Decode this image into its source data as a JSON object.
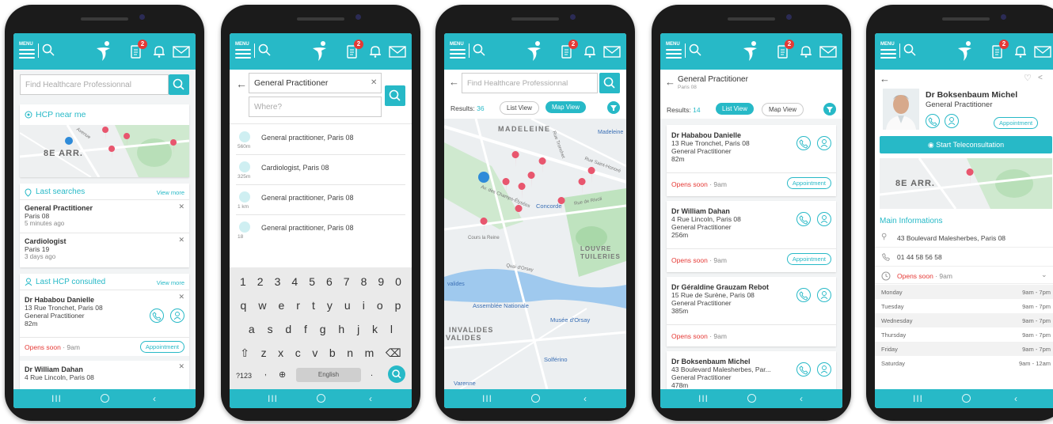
{
  "header": {
    "badge_count": "2"
  },
  "colors": {
    "accent": "#27b9c7",
    "alert": "#e53935",
    "pin": "#e8566e"
  },
  "icons": [
    "menu-icon",
    "search-icon",
    "logo-icon",
    "document-icon",
    "bell-icon",
    "mail-icon",
    "back-arrow-icon",
    "close-icon",
    "location-pin-icon",
    "clock-icon",
    "phone-icon",
    "user-icon",
    "filter-icon",
    "heart-icon",
    "share-icon",
    "video-icon"
  ],
  "menu_label": "MENU",
  "screen1": {
    "search_placeholder": "Find Healthcare Professionnal",
    "hcp_near": "HCP near me",
    "map_label": "8E ARR.",
    "map_label2": "Avenue",
    "last_searches": "Last searches",
    "view_more": "View more",
    "searches": [
      {
        "title": "General Practitioner",
        "place": "Paris 08",
        "time": "5 minutes ago"
      },
      {
        "title": "Cardiologist",
        "place": "Paris 19",
        "time": "3 days ago"
      }
    ],
    "last_consulted": "Last HCP consulted",
    "view_more2": "View more",
    "hcp1": {
      "name": "Dr Hababou Danielle",
      "addr": "13 Rue Tronchet, Paris 08",
      "spec": "General Practitioner",
      "dist": "82m",
      "status": "Opens soon",
      "time": "· 9am",
      "btn": "Appointment"
    },
    "hcp2": {
      "name": "Dr William Dahan",
      "addr": "4 Rue Lincoln, Paris 08"
    }
  },
  "screen2": {
    "query": "General Practitioner",
    "where_placeholder": "Where?",
    "suggestions": [
      {
        "dist": "560m",
        "text": "General practitioner, Paris 08"
      },
      {
        "dist": "325m",
        "text": "Cardiologist, Paris 08"
      },
      {
        "dist": "1 km",
        "text": "General practitioner, Paris 08"
      },
      {
        "dist": "18",
        "text": "General practitioner, Paris 08"
      }
    ],
    "keys_num": [
      "1",
      "2",
      "3",
      "4",
      "5",
      "6",
      "7",
      "8",
      "9",
      "0"
    ],
    "keys_r1": [
      "q",
      "w",
      "e",
      "r",
      "t",
      "y",
      "u",
      "i",
      "o",
      "p"
    ],
    "keys_r2": [
      "a",
      "s",
      "d",
      "f",
      "g",
      "h",
      "j",
      "k",
      "l"
    ],
    "keys_r3": [
      "z",
      "x",
      "c",
      "v",
      "b",
      "n",
      "m"
    ],
    "sym": "?123",
    "comma": ",",
    "globe": "⊕",
    "space": "English",
    "period": "."
  },
  "screen3": {
    "search_placeholder": "Find Healthcare Professionnal",
    "results_label": "Results:",
    "results_count": "36",
    "list_view": "List View",
    "map_view": "Map View",
    "labels": {
      "madeleine": "MADELEINE",
      "madeleine2": "Madeleine",
      "concorde": "Concorde",
      "louvre": "LOUVRE",
      "tuileries": "TUILERIES",
      "cours": "Cours la Reine",
      "assemblee": "Assemblée Nationale",
      "musee": "Musée d'Orsay",
      "invalides": "INVALIDES",
      "invalides2": "VALIDES",
      "invalides3": "valides",
      "solferino": "Solférino",
      "varenne": "Varenne",
      "quai": "Quai d'Orsay",
      "rivoli": "Rue de Rivoli",
      "champs": "Av. des Champs-Élysées",
      "tronchet": "Rue Tronchet",
      "honore": "Rue Saint-Honoré"
    }
  },
  "screen4": {
    "title": "General Practitioner",
    "subtitle": "Paris 08",
    "results_label": "Results:",
    "results_count": "14",
    "list_view": "List View",
    "map_view": "Map View",
    "items": [
      {
        "name": "Dr Hababou Danielle",
        "addr": "13 Rue Tronchet, Paris 08",
        "spec": "General Practitioner",
        "dist": "82m",
        "status": "Opens soon",
        "time": "· 9am",
        "btn": "Appointment"
      },
      {
        "name": "Dr William Dahan",
        "addr": "4 Rue Lincoln, Paris 08",
        "spec": "General Practitioner",
        "dist": "256m",
        "status": "Opens soon",
        "time": "· 9am",
        "btn": "Appointment"
      },
      {
        "name": "Dr Géraldine Grauzam Rebot",
        "addr": "15 Rue de Surène, Paris 08",
        "spec": "General Practitioner",
        "dist": "385m",
        "status": "Opens soon",
        "time": "· 9am"
      },
      {
        "name": "Dr Boksenbaum Michel",
        "addr": "43 Boulevard Malesherbes, Par...",
        "spec": "General Practitioner",
        "dist": "478m"
      }
    ]
  },
  "screen5": {
    "name": "Dr Boksenbaum Michel",
    "spec": "General Practitioner",
    "btn": "Appointment",
    "tele": "Start Teleconsultation",
    "map_label": "8E ARR.",
    "main_info": "Main Informations",
    "address": "43 Boulevard Malesherbes, Paris 08",
    "phone": "01 44 58 56 58",
    "status": "Opens soon",
    "time": "9am",
    "hours": [
      {
        "day": "Monday",
        "h": "9am - 7pm"
      },
      {
        "day": "Tuesday",
        "h": "9am - 7pm"
      },
      {
        "day": "Wednesday",
        "h": "9am - 7pm"
      },
      {
        "day": "Thursday",
        "h": "9am - 7pm"
      },
      {
        "day": "Friday",
        "h": "9am - 7pm"
      },
      {
        "day": "Saturday",
        "h": "9am - 12am"
      }
    ]
  },
  "nav": {
    "recent": "III",
    "back": "‹"
  }
}
